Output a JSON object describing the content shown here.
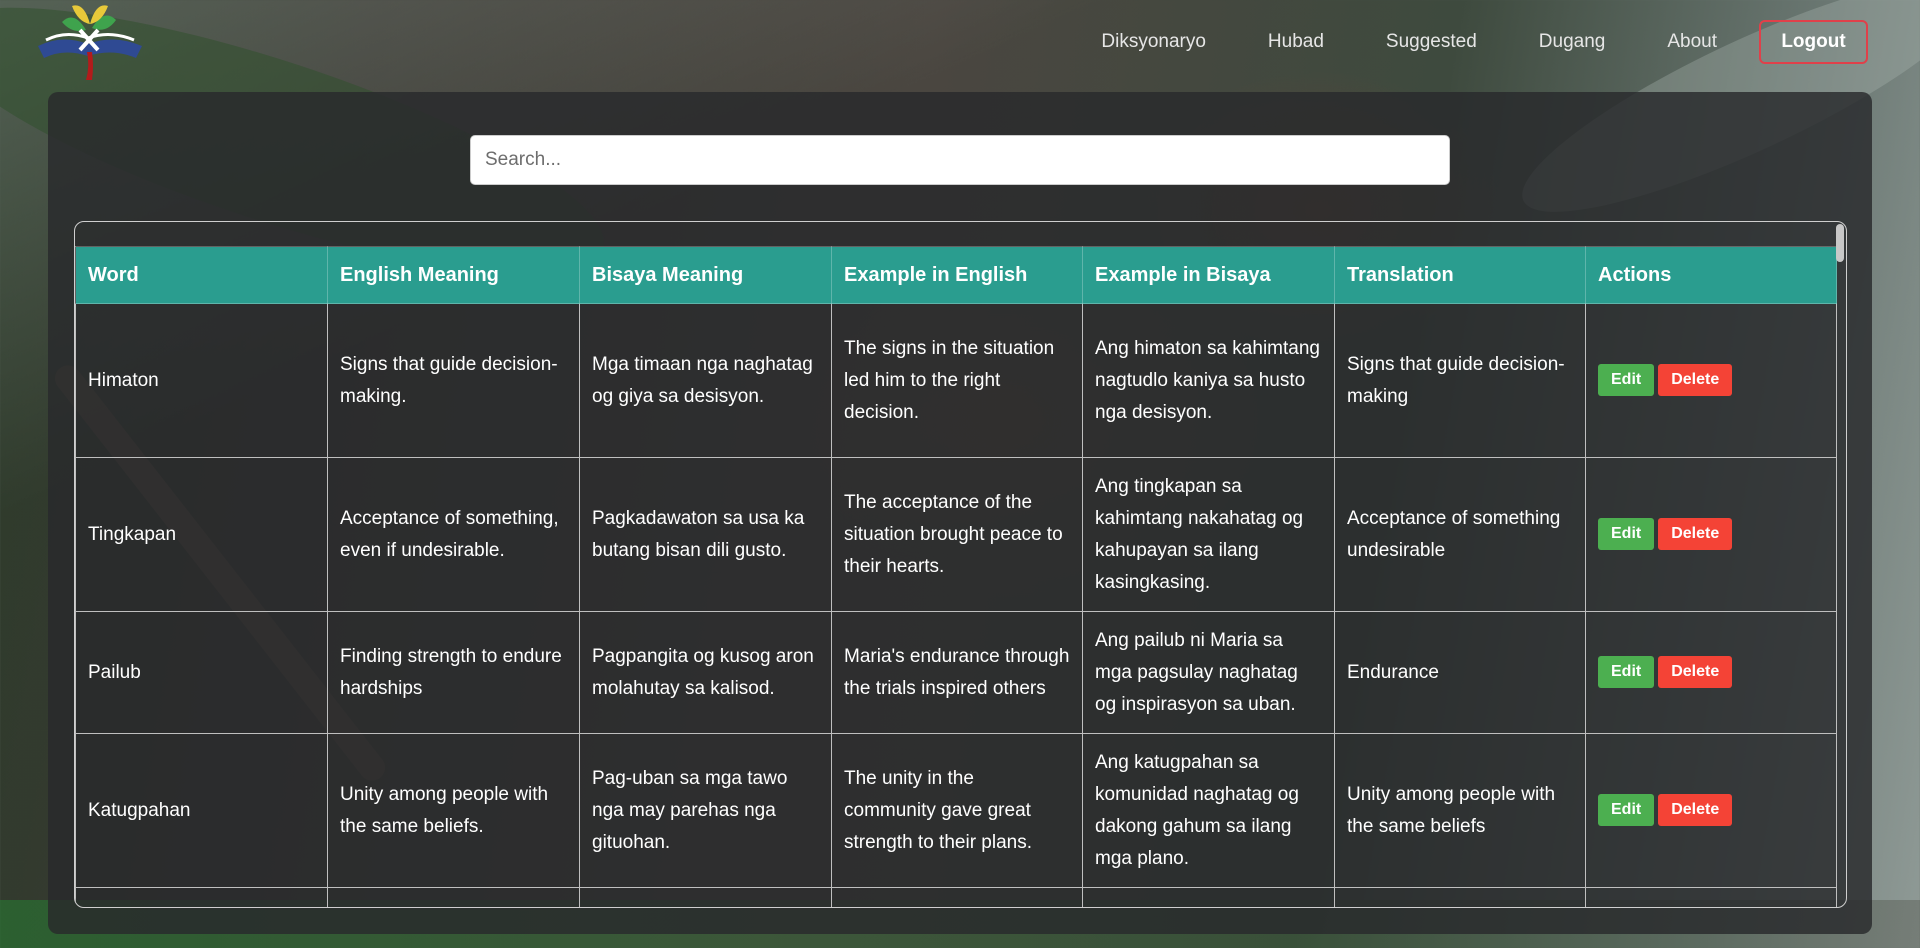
{
  "nav": {
    "links": [
      "Diksyonaryo",
      "Hubad",
      "Suggested",
      "Dugang",
      "About"
    ],
    "logout_label": "Logout"
  },
  "search": {
    "placeholder": "Search...",
    "value": ""
  },
  "table": {
    "headers": [
      "Word",
      "English Meaning",
      "Bisaya Meaning",
      "Example in English",
      "Example in Bisaya",
      "Translation",
      "Actions"
    ],
    "rows": [
      {
        "word": "Himaton",
        "english_meaning": "Signs that guide decision-making.",
        "bisaya_meaning": "Mga timaan nga naghatag og giya sa desisyon.",
        "example_english": "The signs in the situation led him to the right decision.",
        "example_bisaya": "Ang himaton sa kahimtang nagtudlo kaniya sa husto nga desisyon.",
        "translation": "Signs that guide decision-making"
      },
      {
        "word": "Tingkapan",
        "english_meaning": "Acceptance of something, even if undesirable.",
        "bisaya_meaning": "Pagkadawaton sa usa ka butang bisan dili gusto.",
        "example_english": "The acceptance of the situation brought peace to their hearts.",
        "example_bisaya": "Ang tingkapan sa kahimtang nakahatag og kahupayan sa ilang kasingkasing.",
        "translation": "Acceptance of something undesirable"
      },
      {
        "word": "Pailub",
        "english_meaning": "Finding strength to endure hardships",
        "bisaya_meaning": "Pagpangita og kusog aron molahutay sa kalisod.",
        "example_english": "Maria's endurance through the trials inspired others",
        "example_bisaya": "Ang pailub ni Maria sa mga pagsulay naghatag og inspirasyon sa uban.",
        "translation": "Endurance"
      },
      {
        "word": "Katugpahan",
        "english_meaning": "Unity among people with the same beliefs.",
        "bisaya_meaning": "Pag-uban sa mga tawo nga may parehas nga gituohan.",
        "example_english": "The unity in the community gave great strength to their plans.",
        "example_bisaya": "Ang katugpahan sa komunidad naghatag og dakong gahum sa ilang mga plano.",
        "translation": "Unity among people with the same beliefs"
      }
    ],
    "edit_label": "Edit",
    "delete_label": "Delete"
  }
}
